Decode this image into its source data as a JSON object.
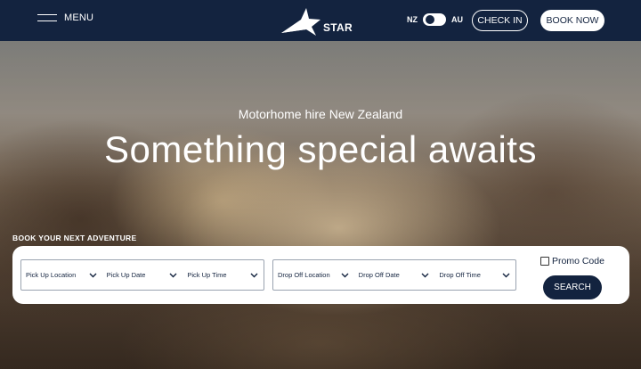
{
  "header": {
    "menu_label": "MENU",
    "logo_text": "STAR",
    "region_left": "NZ",
    "region_right": "AU",
    "checkin_label": "CHECK IN",
    "book_label": "BOOK NOW"
  },
  "hero": {
    "subtitle": "Motorhome hire New Zealand",
    "title": "Something special awaits",
    "book_section_label": "BOOK YOUR NEXT ADVENTURE"
  },
  "booking": {
    "pickup_location": "Pick Up Location",
    "pickup_date": "Pick Up Date",
    "pickup_time": "Pick Up Time",
    "dropoff_location": "Drop Off Location",
    "dropoff_date": "Drop Off Date",
    "dropoff_time": "Drop Off Time",
    "promo_label": "Promo Code",
    "search_label": "SEARCH"
  },
  "colors": {
    "navy": "#13233f",
    "white": "#ffffff"
  },
  "icons": [
    "hamburger-icon",
    "star-logo-icon",
    "chevron-down-icon",
    "checkbox-icon"
  ]
}
